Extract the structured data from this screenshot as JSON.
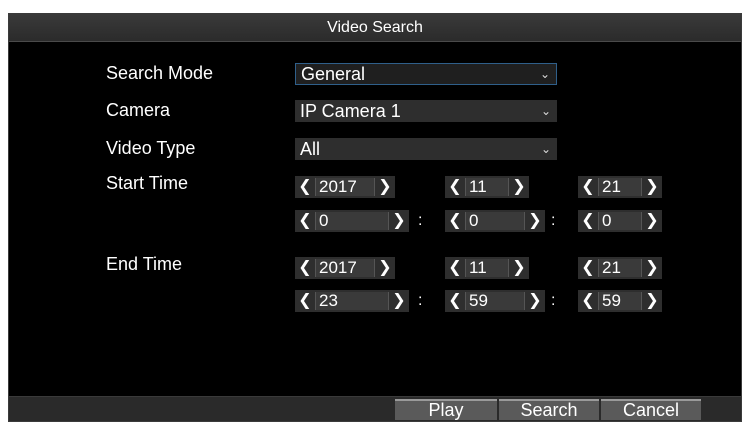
{
  "dialog": {
    "title": "Video Search",
    "labels": {
      "search_mode": "Search Mode",
      "camera": "Camera",
      "video_type": "Video Type",
      "start_time": "Start Time",
      "end_time": "End Time"
    },
    "fields": {
      "search_mode": "General",
      "camera": "IP Camera 1",
      "video_type": "All"
    },
    "start": {
      "year": "2017",
      "month": "11",
      "day": "21",
      "hour": "0",
      "minute": "0",
      "second": "0"
    },
    "end": {
      "year": "2017",
      "month": "11",
      "day": "21",
      "hour": "23",
      "minute": "59",
      "second": "59"
    },
    "separator": ":",
    "arrows": {
      "left": "❮",
      "right": "❯",
      "caret": "⌄"
    },
    "buttons": {
      "play": "Play",
      "search": "Search",
      "cancel": "Cancel"
    }
  }
}
